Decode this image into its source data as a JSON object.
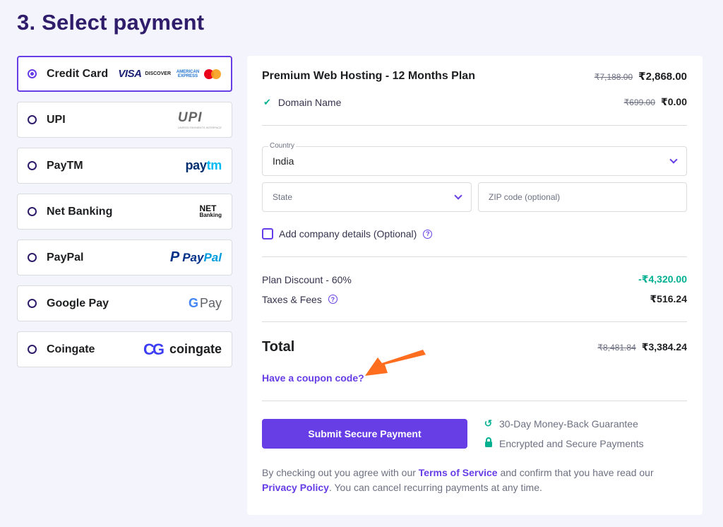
{
  "page": {
    "title": "3. Select payment"
  },
  "payment_methods": [
    {
      "label": "Credit Card",
      "selected": true,
      "logo": {
        "visa": "VISA",
        "discover": "DISCOVER",
        "amex": "AMERICAN EXPRESS",
        "mastercard_icon": "mastercard-icon"
      }
    },
    {
      "label": "UPI",
      "selected": false,
      "logo": {
        "text": "UPI",
        "sub": "UNIFIED PAYMENTS INTERFACE"
      }
    },
    {
      "label": "PayTM",
      "selected": false,
      "logo": {
        "a": "pay",
        "b": "tm"
      }
    },
    {
      "label": "Net Banking",
      "selected": false,
      "logo": {
        "a": "NET",
        "b": "Banking"
      }
    },
    {
      "label": "PayPal",
      "selected": false,
      "logo": {
        "mark": "P",
        "a": "Pay",
        "b": "Pal"
      }
    },
    {
      "label": "Google Pay",
      "selected": false,
      "logo": {
        "g": "G",
        "text": "Pay"
      }
    },
    {
      "label": "Coingate",
      "selected": false,
      "logo": {
        "mark": "CG",
        "text": "coingate"
      }
    }
  ],
  "summary": {
    "plan": {
      "name": "Premium Web Hosting - 12 Months Plan",
      "old_price": "₹7,188.00",
      "price": "₹2,868.00"
    },
    "domain": {
      "name": "Domain Name",
      "old_price": "₹699.00",
      "price": "₹0.00"
    },
    "country": {
      "label": "Country",
      "value": "India"
    },
    "state": {
      "placeholder": "State"
    },
    "zip": {
      "placeholder": "ZIP code (optional)"
    },
    "company": {
      "label": "Add company details (Optional)"
    },
    "discount": {
      "label": "Plan Discount - 60%",
      "value": "-₹4,320.00"
    },
    "taxes": {
      "label": "Taxes & Fees",
      "value": "₹516.24"
    },
    "total": {
      "label": "Total",
      "old_price": "₹8,481.84",
      "price": "₹3,384.24"
    },
    "coupon": {
      "label": "Have a coupon code?"
    },
    "submit": {
      "label": "Submit Secure Payment"
    },
    "guarantees": [
      "30-Day Money-Back Guarantee",
      "Encrypted and Secure Payments"
    ],
    "legal": {
      "part1": "By checking out you agree with our ",
      "terms": "Terms of Service",
      "part2": " and confirm that you have read our ",
      "privacy": "Privacy Policy",
      "part3": ". You can cancel recurring payments at any time."
    }
  },
  "colors": {
    "accent": "#673de6",
    "success": "#00b090",
    "title": "#2f1c6a",
    "annotation_arrow": "#ff6d1f"
  }
}
